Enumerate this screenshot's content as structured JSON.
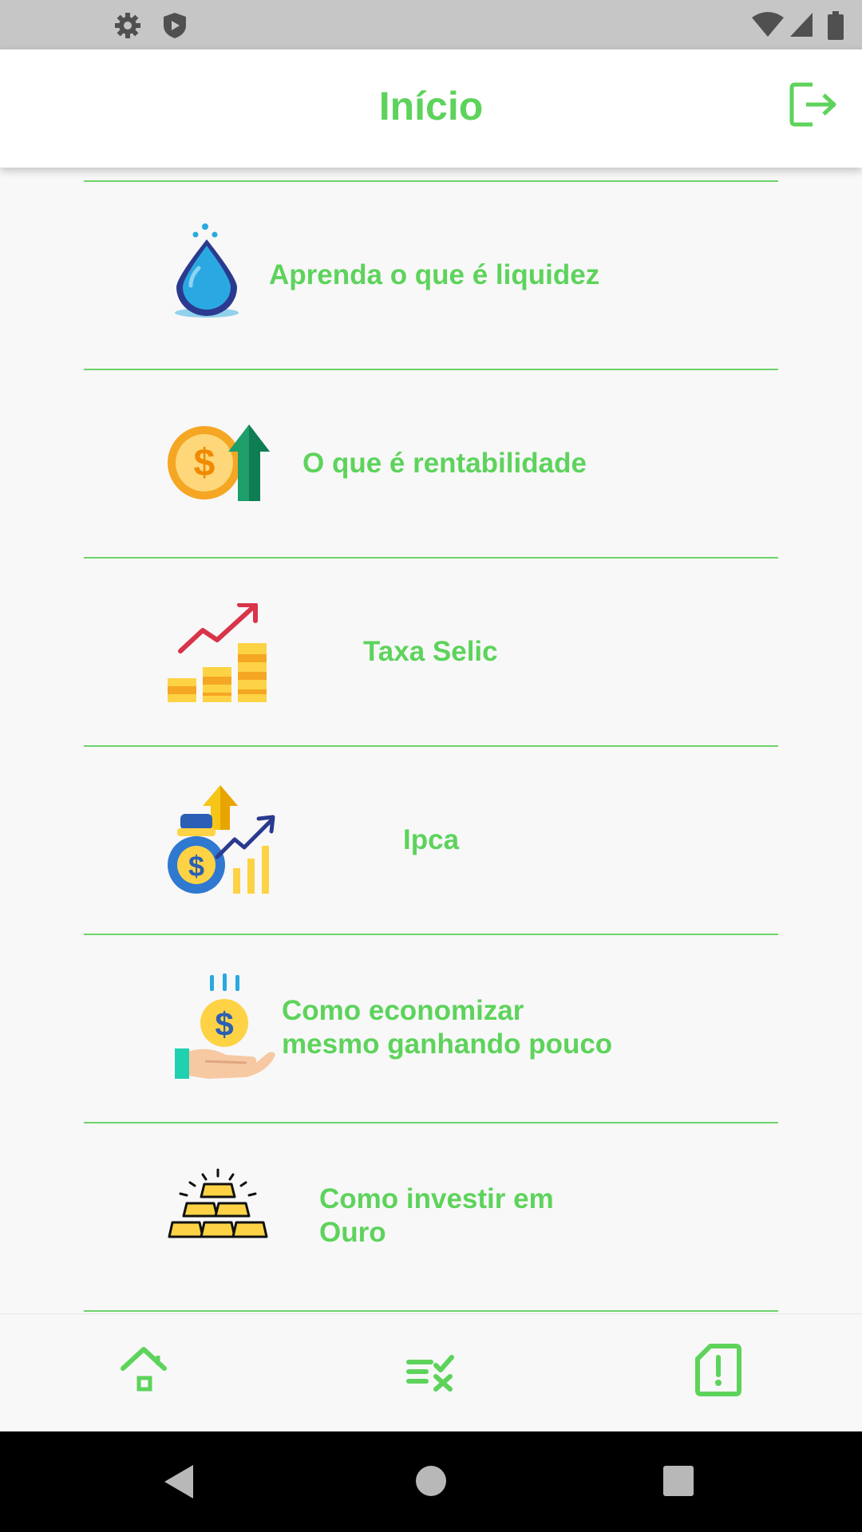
{
  "app_bar": {
    "title": "Início",
    "logout_icon": "logout-icon"
  },
  "status_bar": {
    "left_icons": [
      "settings-icon",
      "shield-icon"
    ],
    "right_icons": [
      "wifi-icon",
      "signal-icon",
      "battery-icon"
    ]
  },
  "topics": [
    {
      "label": "Aprenda o que é liquidez",
      "icon": "water-drop-icon"
    },
    {
      "label": "O que é rentabilidade",
      "icon": "coin-arrow-up-icon"
    },
    {
      "label": "Taxa Selic",
      "icon": "growth-chart-icon"
    },
    {
      "label": "Ipca",
      "icon": "money-bag-chart-icon"
    },
    {
      "label": "Como economizar\nmesmo ganhando pouco",
      "icon": "hand-coin-icon"
    },
    {
      "label": "Como investir em\nOuro",
      "icon": "gold-bars-icon"
    }
  ],
  "bottom_nav": {
    "items": [
      "home-icon",
      "checklist-icon",
      "report-icon"
    ]
  },
  "system_nav": {
    "items": [
      "back-icon",
      "home-circle-icon",
      "recents-icon"
    ]
  },
  "colors": {
    "accent": "#5dd35b",
    "divider": "#6dd36b",
    "status_bar": "#c6c6c6",
    "background": "#f8f8f8"
  }
}
